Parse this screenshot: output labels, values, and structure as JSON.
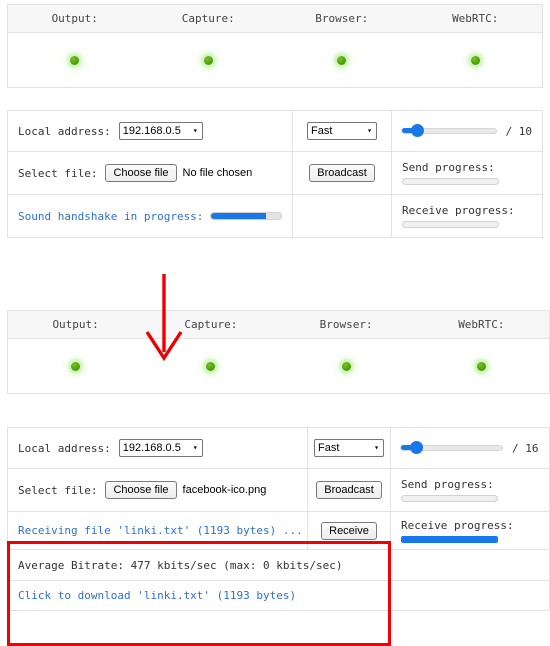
{
  "panels": [
    {
      "id": "panel-top",
      "status": {
        "headers": [
          "Output:",
          "Capture:",
          "Browser:",
          "WebRTC:"
        ],
        "leds": [
          "green",
          "green",
          "green",
          "green"
        ]
      },
      "rows": {
        "address": {
          "label": "Local address:",
          "selected": "192.168.0.5",
          "options": [
            "192.168.0.5"
          ],
          "speed_selected": "Fast",
          "speed_options": [
            "Fast"
          ],
          "slider_value": 1,
          "slider_max_label": "/ 10"
        },
        "file": {
          "label": "Select file:",
          "choose_label": "Choose file",
          "file_name": "No file chosen",
          "broadcast_label": "Broadcast",
          "send_progress_label": "Send progress:",
          "send_progress_pct": 0
        },
        "handshake": {
          "label": "Sound handshake in progress:",
          "handshake_pct": 78,
          "receive_progress_label": "Receive progress:",
          "receive_progress_pct": 0
        }
      }
    },
    {
      "id": "panel-bottom",
      "status": {
        "headers": [
          "Output:",
          "Capture:",
          "Browser:",
          "WebRTC:"
        ],
        "leds": [
          "green",
          "green",
          "green",
          "green"
        ]
      },
      "rows": {
        "address": {
          "label": "Local address:",
          "selected": "192.168.0.5",
          "options": [
            "192.168.0.5"
          ],
          "speed_selected": "Fast",
          "speed_options": [
            "Fast"
          ],
          "slider_value": 1,
          "slider_max_label": "/ 16"
        },
        "file": {
          "label": "Select file:",
          "choose_label": "Choose file",
          "file_name": "facebook-ico.png",
          "broadcast_label": "Broadcast",
          "send_progress_label": "Send progress:",
          "send_progress_pct": 0
        },
        "receiving": {
          "status_text": "Receiving file 'linki.txt' (1193 bytes) ...",
          "receive_button_label": "Receive",
          "receive_progress_label": "Receive progress:",
          "receive_progress_pct": 100
        },
        "bitrate": {
          "text": "Average Bitrate: 477 kbits/sec (max: 0 kbits/sec)"
        },
        "download": {
          "text": "Click to download 'linki.txt' (1193 bytes)"
        }
      }
    }
  ],
  "annotations": {
    "arrow_color": "#ee0000",
    "highlight_color": "#f50000"
  },
  "icons": {
    "caret": "▾"
  }
}
